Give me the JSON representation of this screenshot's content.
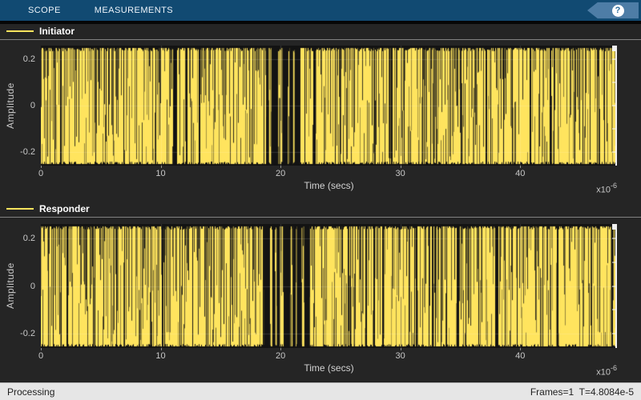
{
  "toolbar": {
    "tabs": [
      {
        "label": "SCOPE"
      },
      {
        "label": "MEASUREMENTS"
      }
    ],
    "help_label": "?"
  },
  "status": {
    "left": "Processing",
    "right": "Frames=1  T=4.8084e-5"
  },
  "colors": {
    "signal_yellow": "#ffe45e",
    "toolstrip_blue": "#114a72",
    "help_flag_blue": "#4e7da6",
    "plot_background": "#131313",
    "canvas_background": "#252525",
    "status_background": "#e6e6e6"
  },
  "chart_data": [
    {
      "type": "line",
      "series": [
        {
          "name": "Initiator",
          "color": "#ffe45e"
        }
      ],
      "xlabel": "Time (secs)",
      "x_multiplier_base": "x10",
      "x_multiplier_exponent": "-6",
      "ylabel": "Amplitude",
      "xlim_us": [
        0,
        48.084
      ],
      "ylim": [
        -0.26,
        0.26
      ],
      "xticks": [
        "0",
        "10",
        "20",
        "30",
        "40"
      ],
      "yticks": [
        "0.2",
        "0",
        "-0.2"
      ],
      "grid": true,
      "legend_position": "top-left",
      "signal": {
        "kind": "dense high-frequency burst waveform filling the axes",
        "envelope_amplitude": 0.25,
        "quiet_gap_us": [
          18.8,
          21.7
        ]
      }
    },
    {
      "type": "line",
      "series": [
        {
          "name": "Responder",
          "color": "#ffe45e"
        }
      ],
      "xlabel": "Time (secs)",
      "x_multiplier_base": "x10",
      "x_multiplier_exponent": "-6",
      "ylabel": "Amplitude",
      "xlim_us": [
        0,
        48.084
      ],
      "ylim": [
        -0.26,
        0.26
      ],
      "xticks": [
        "0",
        "10",
        "20",
        "30",
        "40"
      ],
      "yticks": [
        "0.2",
        "0",
        "-0.2"
      ],
      "grid": true,
      "legend_position": "top-left",
      "signal": {
        "kind": "dense high-frequency burst waveform filling the axes",
        "envelope_amplitude": 0.25,
        "quiet_gap_us": [
          18.6,
          22.2
        ]
      }
    }
  ]
}
